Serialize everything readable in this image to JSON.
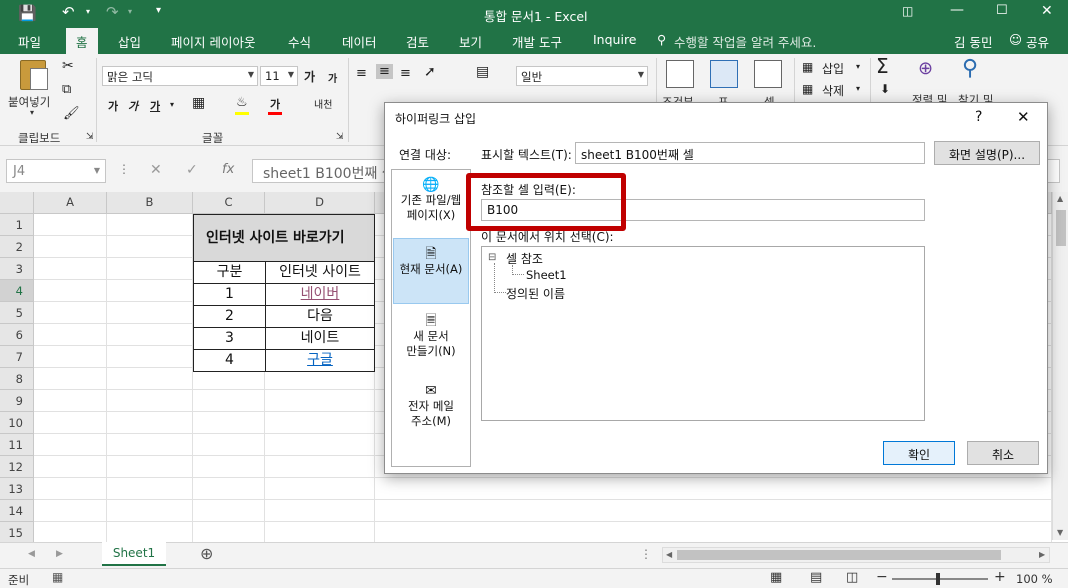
{
  "titlebar": {
    "title": "통합 문서1  -  Excel",
    "save_icon": "save-icon",
    "undo_icon": "undo-icon",
    "redo_icon": "redo-icon"
  },
  "tabs": [
    "파일",
    "홈",
    "삽입",
    "페이지 레이아웃",
    "수식",
    "데이터",
    "검토",
    "보기",
    "개발 도구",
    "Inquire"
  ],
  "tell_me": "수행할 작업을 알려 주세요.",
  "user": "김 동민",
  "share": "공유",
  "ribbon": {
    "paste": "붙여넣기",
    "clipboard_group": "클립보드",
    "font_name": "맑은 고딕",
    "font_size": "11",
    "font_group": "글꼴",
    "bold": "가",
    "italic": "가",
    "underline": "가",
    "grow": "가",
    "shrink": "가",
    "font_color": "가",
    "phonetic": "내천",
    "number_format": "일반",
    "cond_format": "조건부",
    "table_format": "표",
    "cell_style": "셀",
    "insert": "삽입",
    "delete": "삭제",
    "sort": "정렬 및",
    "find": "찾기 및"
  },
  "formula": {
    "namebox": "J4",
    "fx": "fx",
    "content": "sheet1 B100번째 셀"
  },
  "columns": [
    "A",
    "B",
    "C",
    "D"
  ],
  "rows": [
    "1",
    "2",
    "3",
    "4",
    "5",
    "6",
    "7",
    "8",
    "9",
    "10",
    "11",
    "12",
    "13",
    "14",
    "15"
  ],
  "table": {
    "title": "인터넷 사이트 바로가기",
    "header_no": "구분",
    "header_site": "인터넷 사이트",
    "rows": [
      {
        "no": "1",
        "site": "네이버"
      },
      {
        "no": "2",
        "site": "다음"
      },
      {
        "no": "3",
        "site": "네이트"
      },
      {
        "no": "4",
        "site": "구글"
      }
    ]
  },
  "dialog": {
    "title": "하이퍼링크 삽입",
    "help": "?",
    "close": "✕",
    "link_to": "연결 대상:",
    "display_label": "표시할 텍스트(T):",
    "display_value": "sheet1 B100번째 셀",
    "screentip": "화면 설명(P)...",
    "cell_ref_label": "참조할 셀 입력(E):",
    "cell_ref_value": "B100",
    "place_label": "이 문서에서 위치 선택(C):",
    "tree_root": "셀 참조",
    "tree_sheet": "Sheet1",
    "tree_names": "정의된 이름",
    "nav": [
      {
        "line1": "기존 파일/웹",
        "line2": "페이지(X)"
      },
      {
        "line1": "현재 문서(A)",
        "line2": ""
      },
      {
        "line1": "새 문서",
        "line2": "만들기(N)"
      },
      {
        "line1": "전자 메일",
        "line2": "주소(M)"
      }
    ],
    "ok": "확인",
    "cancel": "취소",
    "highlight_color": "#c00000"
  },
  "sheet_tab": "Sheet1",
  "status": {
    "ready": "준비",
    "zoom": "100 %"
  }
}
